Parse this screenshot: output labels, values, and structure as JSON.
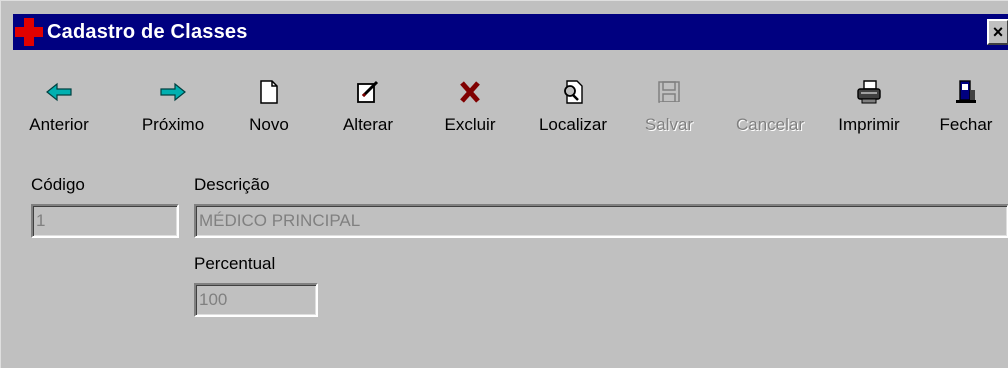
{
  "window": {
    "title": "Cadastro de Classes",
    "close_label": "×"
  },
  "toolbar": {
    "buttons": [
      {
        "label": "Anterior",
        "icon": "arrow-left-icon",
        "enabled": true
      },
      {
        "label": "Próximo",
        "icon": "arrow-right-icon",
        "enabled": true
      },
      {
        "label": "Novo",
        "icon": "new-document-icon",
        "enabled": true
      },
      {
        "label": "Alterar",
        "icon": "edit-icon",
        "enabled": true
      },
      {
        "label": "Excluir",
        "icon": "delete-x-icon",
        "enabled": true
      },
      {
        "label": "Localizar",
        "icon": "find-document-icon",
        "enabled": true
      },
      {
        "label": "Salvar",
        "icon": "save-disk-icon",
        "enabled": false
      },
      {
        "label": "Cancelar",
        "icon": "cancel-icon",
        "enabled": false
      },
      {
        "label": "Imprimir",
        "icon": "printer-icon",
        "enabled": true
      },
      {
        "label": "Fechar",
        "icon": "exit-door-icon",
        "enabled": true
      }
    ]
  },
  "form": {
    "codigo_label": "Código",
    "codigo_value": "1",
    "descricao_label": "Descrição",
    "descricao_value": "MÉDICO PRINCIPAL",
    "percentual_label": "Percentual",
    "percentual_value": "100"
  },
  "colors": {
    "titlebar": "#000080",
    "face": "#c0c0c0",
    "arrow": "#00a0a0",
    "delete": "#800000"
  }
}
